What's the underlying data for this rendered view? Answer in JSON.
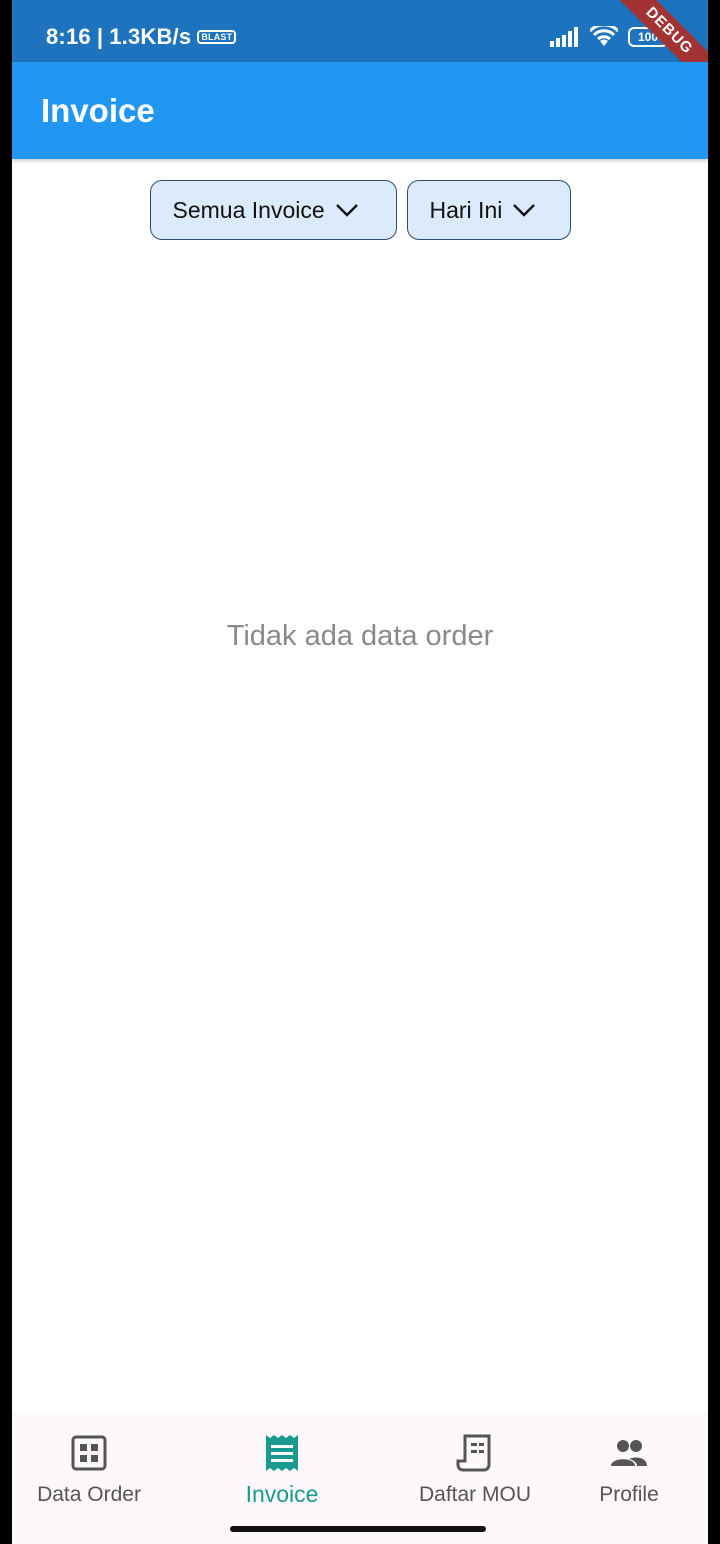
{
  "status_bar": {
    "time": "8:16",
    "network_speed": "1.3KB/s",
    "chip_label": "BLAST",
    "battery": "100",
    "debug_banner": "DEBUG"
  },
  "app_bar": {
    "title": "Invoice"
  },
  "filters": {
    "invoice_type": "Semua Invoice",
    "date_range": "Hari Ini"
  },
  "empty_state": {
    "message": "Tidak ada data order"
  },
  "bottom_nav": {
    "items": [
      {
        "label": "Data Order",
        "icon": "grid-icon"
      },
      {
        "label": "Invoice",
        "icon": "invoice-icon"
      },
      {
        "label": "Daftar MOU",
        "icon": "document-icon"
      },
      {
        "label": "Profile",
        "icon": "people-icon"
      }
    ],
    "active": "Invoice"
  },
  "colors": {
    "app_bar": "#2196f3",
    "status_bar": "#1e73be",
    "filter_bg": "#dcebfb",
    "active_nav": "#1a9a8e",
    "inactive_nav": "#555555"
  }
}
